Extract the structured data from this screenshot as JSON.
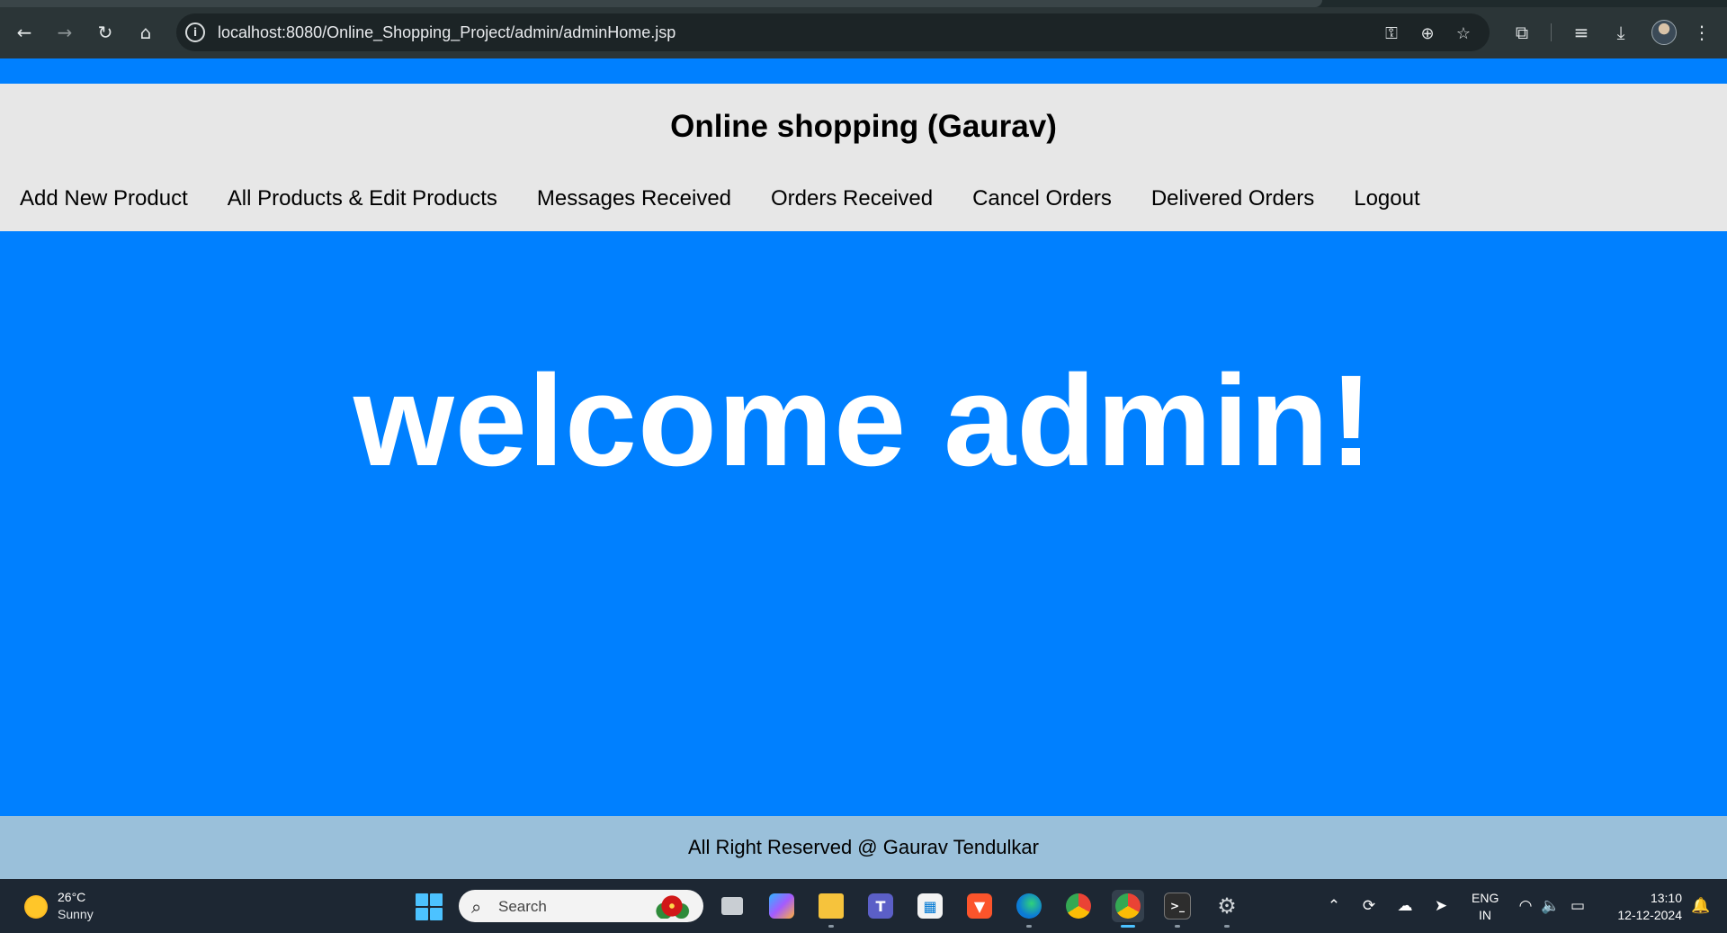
{
  "browser": {
    "url": "localhost:8080/Online_Shopping_Project/admin/adminHome.jsp",
    "icons": [
      "back-icon",
      "forward-icon",
      "reload-icon",
      "home-icon",
      "site-info-icon",
      "password-key-icon",
      "zoom-icon",
      "bookmark-star-icon",
      "extensions-icon",
      "reading-list-icon",
      "download-icon",
      "profile-avatar",
      "menu-icon"
    ]
  },
  "site": {
    "title": "Online shopping (Gaurav)",
    "nav": [
      {
        "label": "Add New Product"
      },
      {
        "label": "All Products & Edit Products"
      },
      {
        "label": "Messages Received"
      },
      {
        "label": "Orders Received"
      },
      {
        "label": "Cancel Orders"
      },
      {
        "label": "Delivered Orders"
      },
      {
        "label": "Logout"
      }
    ],
    "hero_text": "welcome admin!",
    "footer_text": "All Right Reserved @ Gaurav Tendulkar"
  },
  "colors": {
    "page_blue": "#0080ff",
    "header_grey": "#e7e7e7",
    "footer_blue": "#9ac0da",
    "browser_chrome": "#2b3537",
    "taskbar": "#1d2733"
  },
  "taskbar": {
    "weather": {
      "temp": "26°C",
      "desc": "Sunny"
    },
    "search_label": "Search",
    "apps": [
      "task-view",
      "copilot",
      "file-explorer",
      "teams",
      "microsoft-store",
      "brave",
      "edge",
      "chrome",
      "chrome-profile",
      "terminal",
      "settings"
    ],
    "lang_line1": "ENG",
    "lang_line2": "IN",
    "time": "13:10",
    "date": "12-12-2024"
  }
}
